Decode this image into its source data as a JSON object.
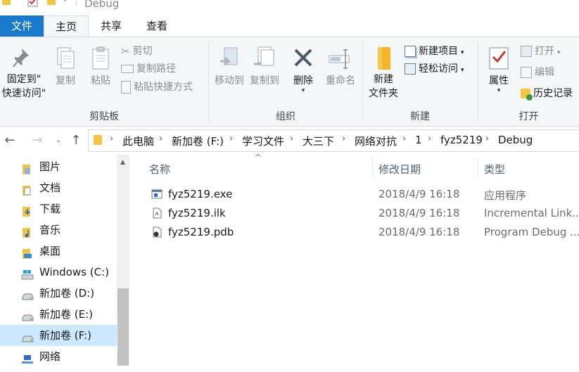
{
  "window": {
    "title": "Debug"
  },
  "tabs": {
    "file": "文件",
    "home": "主页",
    "share": "共享",
    "view": "查看"
  },
  "ribbon": {
    "clipboard": {
      "label": "剪贴板",
      "pin_line1": "固定到\"",
      "pin_line2": "快速访问\"",
      "copy": "复制",
      "paste": "粘贴",
      "cut": "剪切",
      "copy_path": "复制路径",
      "paste_shortcut": "粘贴快捷方式"
    },
    "organize": {
      "label": "组织",
      "move_to": "移动到",
      "copy_to": "复制到",
      "delete": "删除",
      "rename": "重命名"
    },
    "new": {
      "label": "新建",
      "new_folder_line1": "新建",
      "new_folder_line2": "文件夹",
      "new_item": "新建项目",
      "easy_access": "轻松访问"
    },
    "open": {
      "label": "打开",
      "properties": "属性",
      "open": "打开",
      "edit": "编辑",
      "history": "历史记录"
    }
  },
  "breadcrumb": [
    "此电脑",
    "新加卷 (F:)",
    "学习文件",
    "大三下",
    "网络对抗",
    "1",
    "fyz5219",
    "Debug"
  ],
  "nav_pane": {
    "items": [
      {
        "label": "图片",
        "icon": "pictures-folder-icon"
      },
      {
        "label": "文档",
        "icon": "documents-folder-icon"
      },
      {
        "label": "下载",
        "icon": "downloads-folder-icon"
      },
      {
        "label": "音乐",
        "icon": "music-folder-icon"
      },
      {
        "label": "桌面",
        "icon": "desktop-folder-icon"
      },
      {
        "label": "Windows (C:)",
        "icon": "windows-drive-icon"
      },
      {
        "label": "新加卷 (D:)",
        "icon": "drive-icon"
      },
      {
        "label": "新加卷 (E:)",
        "icon": "drive-icon"
      },
      {
        "label": "新加卷 (F:)",
        "icon": "drive-icon",
        "selected": true
      },
      {
        "label": "网络",
        "icon": "network-icon"
      }
    ]
  },
  "file_list": {
    "columns": {
      "name": "名称",
      "modified": "修改日期",
      "type": "类型"
    },
    "rows": [
      {
        "name": "fyz5219.exe",
        "modified": "2018/4/9 16:18",
        "type": "应用程序",
        "icon": "exe-file-icon"
      },
      {
        "name": "fyz5219.ilk",
        "modified": "2018/4/9 16:18",
        "type": "Incremental Link...",
        "icon": "ilk-file-icon"
      },
      {
        "name": "fyz5219.pdb",
        "modified": "2018/4/9 16:18",
        "type": "Program Debug ...",
        "icon": "pdb-file-icon"
      }
    ]
  },
  "colors": {
    "file_tab": "#1979ca",
    "ribbon_bg": "#f5f6f7",
    "selected_nav": "#cce8ff",
    "column_header": "#4c607a"
  }
}
